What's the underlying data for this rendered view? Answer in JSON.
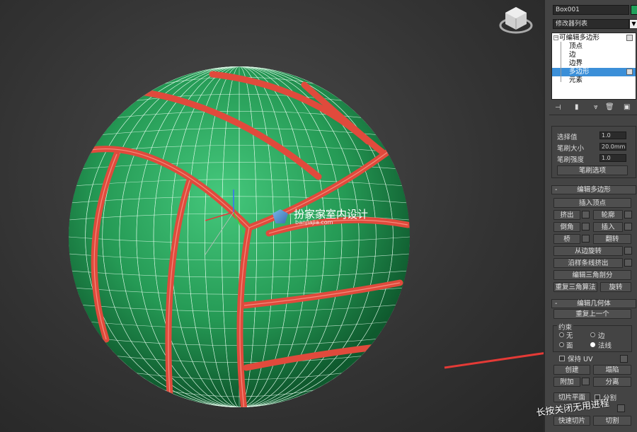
{
  "watermark": {
    "title": "扮家家室内设计",
    "url": "banjiajia.com"
  },
  "overlay_toast": "长按关闭无用进程",
  "panel": {
    "object_name": "Box001",
    "object_color": "#1fa05a",
    "modifier_list_label": "修改器列表",
    "stack": [
      {
        "label": "可编辑多边形",
        "level": 0,
        "selected": false
      },
      {
        "label": "顶点",
        "level": 1,
        "selected": false
      },
      {
        "label": "边",
        "level": 1,
        "selected": false
      },
      {
        "label": "边界",
        "level": 1,
        "selected": false
      },
      {
        "label": "多边形",
        "level": 1,
        "selected": true
      },
      {
        "label": "元素",
        "level": 1,
        "selected": false
      }
    ],
    "soft": {
      "select_value_label": "选择值",
      "select_value": "1.0",
      "brush_size_label": "笔刷大小",
      "brush_size": "20.0mm",
      "brush_strength_label": "笔刷强度",
      "brush_strength": "1.0",
      "brush_options": "笔刷选项"
    },
    "edit_poly": {
      "title": "编辑多边形",
      "insert_vertex": "插入顶点",
      "extrude": "挤出",
      "outline": "轮廓",
      "bevel": "倒角",
      "inset": "插入",
      "bridge": "桥",
      "flip": "翻转",
      "hinge": "从边旋转",
      "extrude_spline": "沿样条线挤出",
      "edit_tri": "编辑三角剖分",
      "retriangulate": "重复三角算法",
      "turn": "旋转"
    },
    "edit_geo": {
      "title": "编辑几何体",
      "repeat_last": "重复上一个",
      "constraints": "约束",
      "none": "无",
      "edge": "边",
      "face": "面",
      "normal": "法线",
      "preserve_uv": "保持 UV",
      "create": "创建",
      "collapse": "塌陷",
      "attach": "附加",
      "detach": "分离",
      "slice_plane": "切片平面",
      "split": "分割",
      "quickslice": "快速切片",
      "cut": "切割"
    }
  },
  "colors": {
    "ball": "#2fae63",
    "seam": "#e04a3c",
    "highlight": "#3b8fd8",
    "arrow": "#e43a36"
  }
}
